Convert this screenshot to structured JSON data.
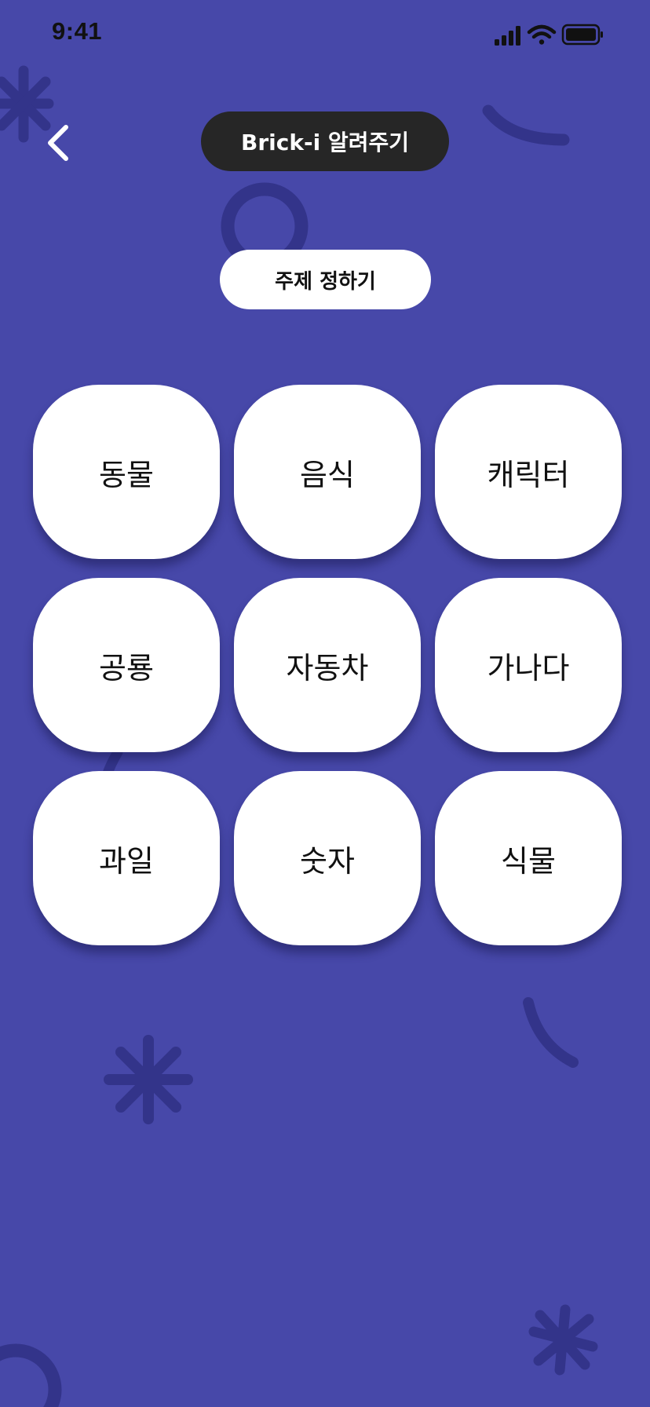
{
  "status_bar": {
    "time": "9:41",
    "icons": [
      "cellular-signal-icon",
      "wifi-icon",
      "battery-icon"
    ]
  },
  "header": {
    "back_icon": "chevron-left-icon",
    "title": "Brick-i 알려주기"
  },
  "subtitle": "주제 정하기",
  "topics": [
    {
      "label": "동물"
    },
    {
      "label": "음식"
    },
    {
      "label": "캐릭터"
    },
    {
      "label": "공룡"
    },
    {
      "label": "자동차"
    },
    {
      "label": "가나다"
    },
    {
      "label": "과일"
    },
    {
      "label": "숫자"
    },
    {
      "label": "식물"
    }
  ],
  "colors": {
    "background": "#4748A9",
    "decoration": "#33348A",
    "title_pill": "#262626",
    "card": "#FFFFFF",
    "text_dark": "#111111",
    "text_light": "#FFFFFF"
  }
}
